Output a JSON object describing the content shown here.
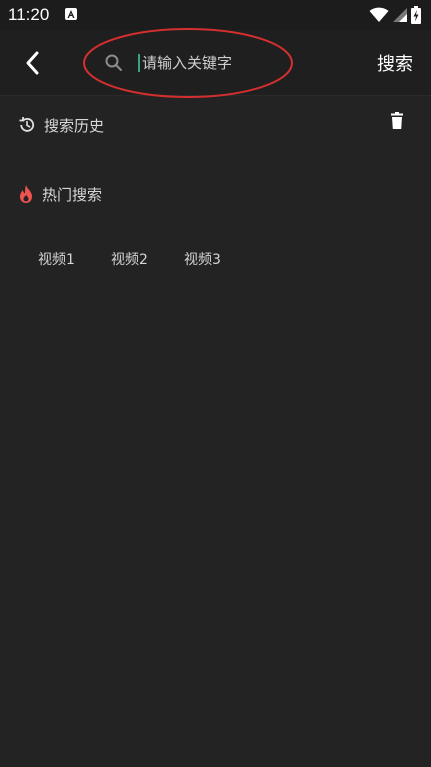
{
  "status_bar": {
    "time": "11:20",
    "icons": [
      "app-notification-icon",
      "wifi-icon",
      "signal-icon",
      "battery-icon"
    ]
  },
  "toolbar": {
    "back_icon": "back-arrow-icon",
    "search_icon": "search-icon",
    "search_placeholder": "请输入关键字",
    "search_value": "",
    "search_button": "搜索"
  },
  "history": {
    "title": "搜索历史",
    "icon": "history-icon",
    "delete_icon": "trash-icon"
  },
  "hot": {
    "title": "热门搜索",
    "icon": "fire-icon",
    "items": [
      "视频1",
      "视频2",
      "视频3"
    ]
  },
  "colors": {
    "background": "#232323",
    "toolbar": "#1f1f1f",
    "accent_fire": "#ef5350",
    "annotation_ellipse": "#d32f2f",
    "cursor": "#3aa57a"
  }
}
